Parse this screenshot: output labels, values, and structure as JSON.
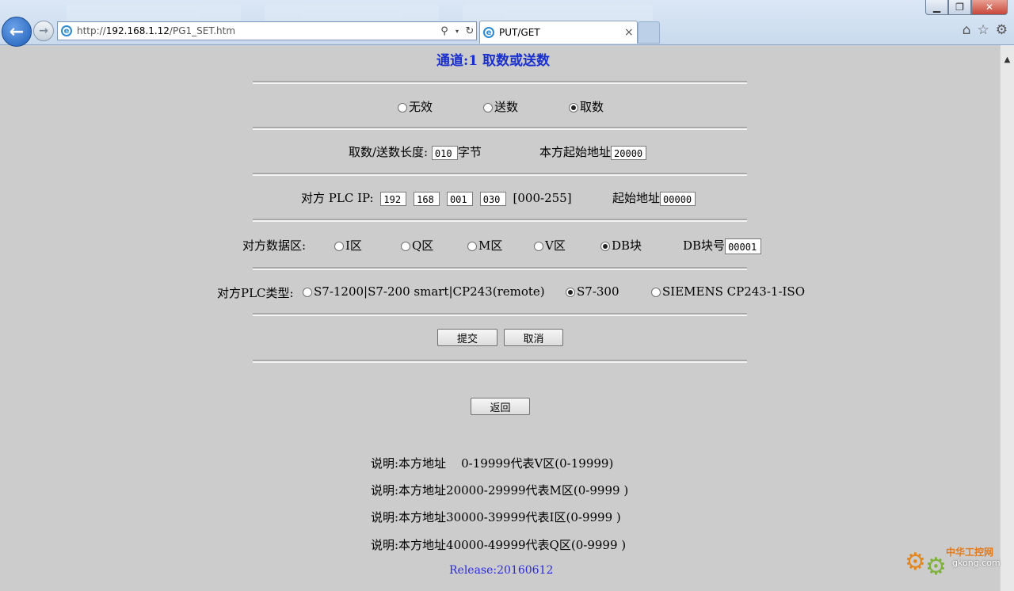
{
  "browser": {
    "url_prefix": "http://",
    "url_host": "192.168.1.12",
    "url_path": "/PG1_SET.htm",
    "tab_title": "PUT/GET",
    "tab_close": "×",
    "icons": [
      "back-arrow-icon",
      "forward-arrow-icon",
      "ie-icon",
      "search-icon",
      "refresh-icon",
      "home-icon",
      "favorites-star-icon",
      "settings-gear-icon"
    ]
  },
  "page": {
    "title": "通道:1 取数或送数",
    "mode": {
      "options": [
        "无效",
        "送数",
        "取数"
      ],
      "selected": "取数"
    },
    "length": {
      "label": "取数/送数长度:",
      "value": "010",
      "unit": "字节",
      "local_start_label": "本方起始地址",
      "local_start_value": "20000"
    },
    "remote_ip": {
      "label": "对方 PLC IP:",
      "octets": [
        "192",
        "168",
        "001",
        "030"
      ],
      "range_hint": "[000-255]",
      "start_label": "起始地址",
      "start_value": "00000"
    },
    "remote_area": {
      "label": "对方数据区:",
      "options": [
        "I区",
        "Q区",
        "M区",
        "V区",
        "DB块"
      ],
      "selected": "DB块",
      "db_label": "DB块号",
      "db_value": "00001"
    },
    "plc_type": {
      "label": "对方PLC类型:",
      "options": [
        "S7-1200|S7-200 smart|CP243(remote)",
        "S7-300",
        "SIEMENS CP243-1-ISO"
      ],
      "selected": "S7-300"
    },
    "buttons": {
      "submit": "提交",
      "cancel": "取消",
      "back": "返回"
    },
    "notes": [
      "说明:本方地址    0-19999代表V区(0-19999)",
      "说明:本方地址20000-29999代表M区(0-9999 )",
      "说明:本方地址30000-39999代表I区(0-9999 )",
      "说明:本方地址40000-49999代表Q区(0-9999 )"
    ],
    "release": "Release:20160612"
  },
  "watermark": {
    "text_cn": "中华工控网",
    "text_en": "gkong.com"
  },
  "colors": {
    "page_bg": "#cccccc",
    "title": "#1a2fd0",
    "release": "#2a2ae0"
  }
}
